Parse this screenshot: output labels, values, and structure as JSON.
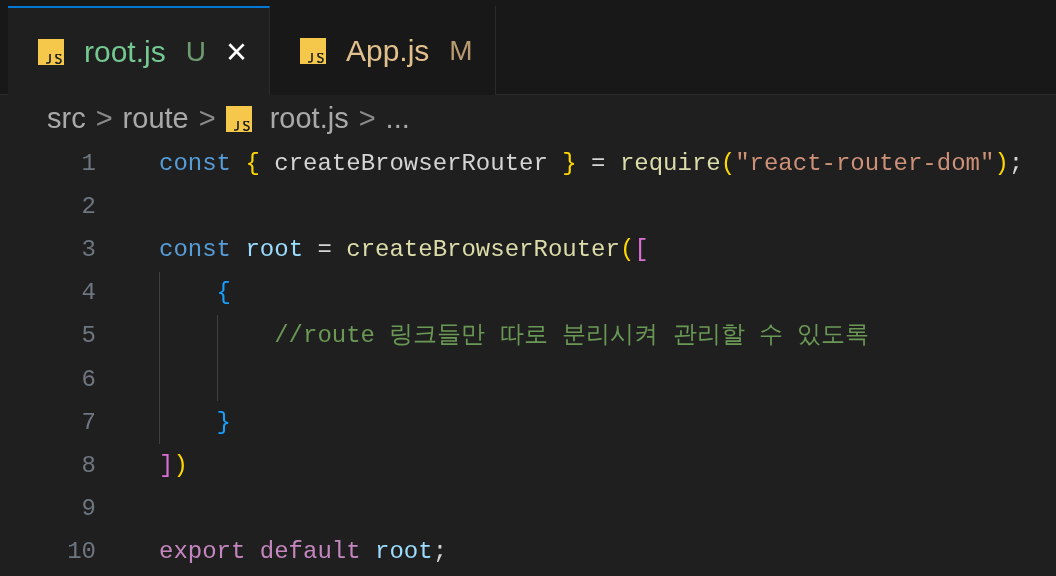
{
  "tabs": [
    {
      "name": "root.js",
      "status": "U",
      "kind": "untracked",
      "selected": true,
      "close": "×"
    },
    {
      "name": "App.js",
      "status": "M",
      "kind": "modified",
      "selected": false
    }
  ],
  "breadcrumb": [
    {
      "kind": "folder",
      "label": "src"
    },
    {
      "kind": "folder",
      "label": "route"
    },
    {
      "kind": "file",
      "label": "root.js"
    },
    {
      "kind": "more",
      "label": "..."
    }
  ],
  "breadcrumb_separator": ">",
  "lines": [
    {
      "number": "1",
      "tokens": [
        {
          "kind": "keyword",
          "text": "const "
        },
        {
          "kind": "brace",
          "text": "{ "
        },
        {
          "kind": "plain",
          "text": "createBrowserRouter "
        },
        {
          "kind": "brace",
          "text": "}"
        },
        {
          "kind": "plain",
          "text": " = "
        },
        {
          "kind": "function",
          "text": "require"
        },
        {
          "kind": "brace",
          "text": "("
        },
        {
          "kind": "string",
          "text": "\"react-router-dom\""
        },
        {
          "kind": "brace",
          "text": ")"
        },
        {
          "kind": "plain",
          "text": ";"
        }
      ]
    },
    {
      "number": "2"
    },
    {
      "number": "3",
      "tokens": [
        {
          "kind": "keyword",
          "text": "const "
        },
        {
          "kind": "variable",
          "text": "root"
        },
        {
          "kind": "plain",
          "text": " = "
        },
        {
          "kind": "function",
          "text": "createBrowserRouter"
        },
        {
          "kind": "brace",
          "text": "("
        },
        {
          "kind": "bracket",
          "text": "["
        }
      ]
    },
    {
      "number": "4",
      "guides": [
        {
          "kind": "line"
        }
      ],
      "tokens": [
        {
          "kind": "object",
          "text": "{"
        }
      ]
    },
    {
      "number": "5",
      "guides": [
        {
          "kind": "line"
        },
        {
          "kind": "line"
        }
      ],
      "tokens": [
        {
          "kind": "comment",
          "text": "//route 링크들만 따로 분리시켜 관리할 수 있도록"
        }
      ]
    },
    {
      "number": "6",
      "guides": [
        {
          "kind": "line"
        },
        {
          "kind": "line"
        }
      ]
    },
    {
      "number": "7",
      "guides": [
        {
          "kind": "line"
        }
      ],
      "tokens": [
        {
          "kind": "object",
          "text": "}"
        }
      ]
    },
    {
      "number": "8",
      "tokens": [
        {
          "kind": "bracket",
          "text": "]"
        },
        {
          "kind": "brace",
          "text": ")"
        }
      ]
    },
    {
      "number": "9"
    },
    {
      "number": "10",
      "tokens": [
        {
          "kind": "control",
          "text": "export default "
        },
        {
          "kind": "variable",
          "text": "root"
        },
        {
          "kind": "plain",
          "text": ";"
        }
      ]
    }
  ]
}
